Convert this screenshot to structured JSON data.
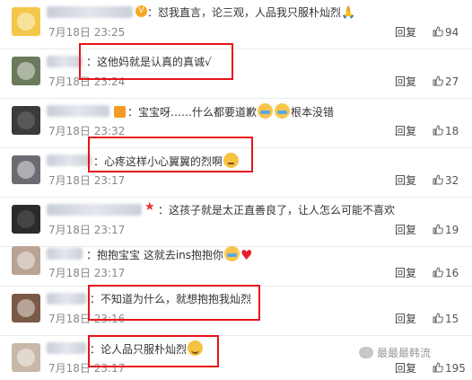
{
  "comments": [
    {
      "text": "：怼我直言，论三观，人品我只服朴灿烈",
      "suffix_icon": "pray-icon",
      "time": "7月18日 23:25",
      "likes": "94",
      "reply": "回复",
      "avatar_color": "#f3c84a",
      "name_w": 96,
      "badge": "vip-badge-icon",
      "highlighted": false
    },
    {
      "text": "：这他妈就是认真的真诚√",
      "time": "7月18日 23:24",
      "likes": "27",
      "reply": "回复",
      "avatar_color": "#6b7a5c",
      "name_w": 40,
      "highlighted": true
    },
    {
      "text": "宝宝呀……什么都要道歉",
      "trail": "根本没错",
      "time": "7月18日 23:32",
      "likes": "18",
      "reply": "回复",
      "avatar_color": "#3b3b3b",
      "name_w": 70,
      "highlighted": false
    },
    {
      "text": "：心疼这样小心翼翼的烈啊",
      "time": "7月18日 23:17",
      "likes": "32",
      "reply": "回复",
      "avatar_color": "#6e6a72",
      "name_w": 50,
      "highlighted": true
    },
    {
      "text": "：这孩子就是太正直善良了，让人怎么可能不喜欢",
      "time": "7月18日 23:17",
      "likes": "19",
      "reply": "回复",
      "avatar_color": "#2b2b2b",
      "name_w": 106,
      "highlighted": false
    },
    {
      "text": "：抱抱宝宝 这就去ins抱抱你",
      "time": "7月18日 23:17",
      "likes": "16",
      "reply": "回复",
      "avatar_color": "#b9a393",
      "name_w": 40,
      "highlighted": false
    },
    {
      "text": "：不知道为什么，就想抱抱我灿烈",
      "time": "7月18日 23:16",
      "likes": "15",
      "reply": "回复",
      "avatar_color": "#7a5a46",
      "name_w": 44,
      "highlighted": true
    },
    {
      "text": "：论人品只服朴灿烈",
      "time": "7月18日 23:17",
      "likes": "195",
      "reply": "回复",
      "avatar_color": "#c8b8a8",
      "name_w": 44,
      "highlighted": true
    }
  ],
  "watermark": "最最最韩流"
}
